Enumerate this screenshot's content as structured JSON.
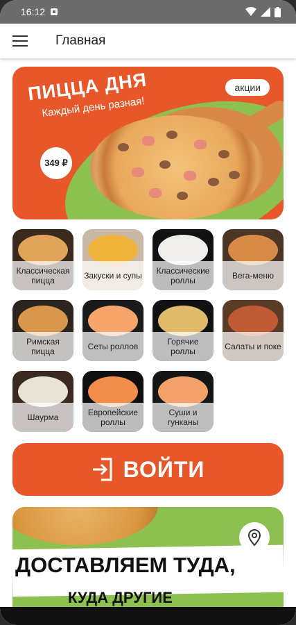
{
  "status_bar": {
    "time": "16:12"
  },
  "app_bar": {
    "title": "Главная"
  },
  "promo_banner": {
    "title": "ПИЦЦА ДНЯ",
    "subtitle": "Каждый день разная!",
    "chip": "акции",
    "price": "349 ₽",
    "colors": {
      "background": "#e8572a",
      "accent": "#8cc152"
    }
  },
  "categories": [
    {
      "label": "Классическая пицца",
      "theme": "pizza"
    },
    {
      "label": "Закуски и супы",
      "theme": "fries"
    },
    {
      "label": "Классические роллы",
      "theme": "rolls"
    },
    {
      "label": "Вега-меню",
      "theme": "pizza-veg"
    },
    {
      "label": "Римская пицца",
      "theme": "roman"
    },
    {
      "label": "Сеты роллов",
      "theme": "set"
    },
    {
      "label": "Горячие роллы",
      "theme": "hot-rolls"
    },
    {
      "label": "Салаты и поке",
      "theme": "salad"
    },
    {
      "label": "Шаурма",
      "theme": "shawarma"
    },
    {
      "label": "Европейские роллы",
      "theme": "euro-rolls"
    },
    {
      "label": "Суши и гунканы",
      "theme": "sushi"
    }
  ],
  "login_button": {
    "label": "ВОЙТИ",
    "icon": "login-icon"
  },
  "delivery_banner": {
    "title": "ДОСТАВЛЯЕМ ТУДА,",
    "subtitle": "КУДА ДРУГИЕ",
    "icon": "map-pin-icon"
  }
}
